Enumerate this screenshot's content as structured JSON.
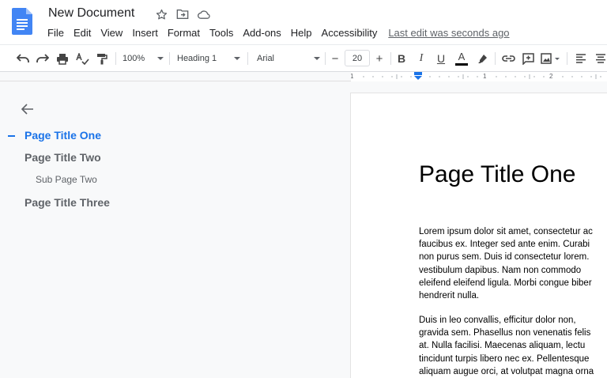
{
  "header": {
    "title": "New Document",
    "menus": [
      "File",
      "Edit",
      "View",
      "Insert",
      "Format",
      "Tools",
      "Add-ons",
      "Help",
      "Accessibility"
    ],
    "last_edit": "Last edit was seconds ago",
    "icons": [
      "star-icon",
      "move-to-folder-icon",
      "cloud-status-icon"
    ]
  },
  "toolbar": {
    "zoom": "100%",
    "style": "Heading 1",
    "font": "Arial",
    "font_size": "20",
    "decrease_label": "−",
    "increase_label": "+",
    "bold_label": "B",
    "italic_label": "I",
    "underline_label": "U",
    "text_color_label": "A"
  },
  "ruler": {
    "numbers": [
      "1",
      "1",
      "2"
    ]
  },
  "outline": {
    "items": [
      {
        "label": "Page Title One",
        "level": 1,
        "active": true
      },
      {
        "label": "Page Title Two",
        "level": 1,
        "active": false
      },
      {
        "label": "Sub Page Two",
        "level": 2,
        "active": false
      },
      {
        "label": "Page Title Three",
        "level": 1,
        "active": false
      }
    ]
  },
  "document": {
    "heading": "Page Title One",
    "paragraph_1": [
      "Lorem ipsum dolor sit amet, consectetur ac",
      "faucibus ex. Integer sed ante enim. Curabi",
      "non purus sem. Duis id consectetur lorem.",
      "vestibulum dapibus. Nam non commodo",
      "eleifend eleifend ligula. Morbi congue biber",
      "hendrerit nulla."
    ],
    "paragraph_2": [
      "Duis in leo convallis, efficitur dolor non,",
      "gravida sem. Phasellus non venenatis felis",
      "at. Nulla facilisi. Maecenas aliquam, lectu",
      "tincidunt turpis libero nec ex. Pellentesque",
      "aliquam augue orci, at volutpat magna orna"
    ]
  },
  "colors": {
    "accent": "#1a73e8",
    "docs_blue": "#4285f4",
    "text": "#202124",
    "muted": "#5f6368"
  }
}
